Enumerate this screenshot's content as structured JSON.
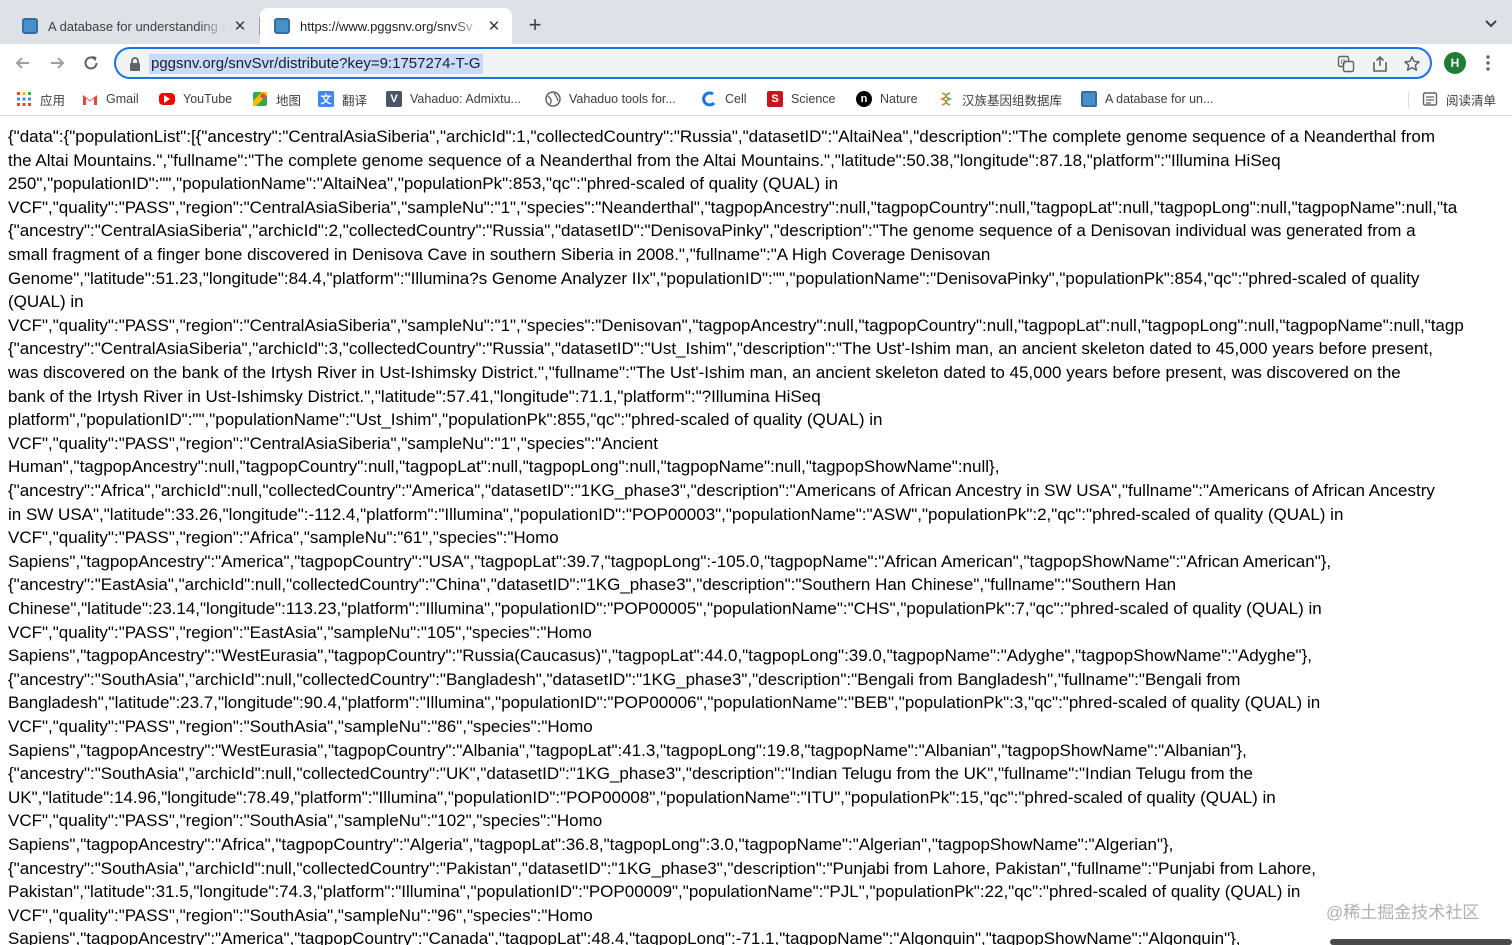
{
  "tabs": [
    {
      "title": "A database for understanding a",
      "close": "✕"
    },
    {
      "title": "https://www.pggsnv.org/snvSv",
      "close": "✕"
    }
  ],
  "new_tab": "+",
  "omnibox": {
    "url": "pggsnv.org/snvSvr/distribute?key=9:1757274-T-G"
  },
  "profile": {
    "initial": "H",
    "color": "#1e7e34"
  },
  "bookmarks": [
    {
      "label": "应用",
      "icon": "apps-grid-icon"
    },
    {
      "label": "Gmail",
      "icon": "gmail-icon"
    },
    {
      "label": "YouTube",
      "icon": "youtube-icon"
    },
    {
      "label": "地图",
      "icon": "maps-icon"
    },
    {
      "label": "翻译",
      "icon": "translate-icon"
    },
    {
      "label": "Vahaduo: Admixtu...",
      "icon": "vahaduo-icon"
    },
    {
      "label": "Vahaduo tools for...",
      "icon": "globe-icon"
    },
    {
      "label": "Cell",
      "icon": "cell-icon"
    },
    {
      "label": "Science",
      "icon": "science-icon"
    },
    {
      "label": "Nature",
      "icon": "nature-icon"
    },
    {
      "label": "汉族基因组数据库",
      "icon": "genome-db-icon"
    },
    {
      "label": "A database for un...",
      "icon": "site-favicon"
    }
  ],
  "reading_list": {
    "label": "阅读清单"
  },
  "json_lines": [
    "{\"data\":{\"populationList\":[{\"ancestry\":\"CentralAsiaSiberia\",\"archicId\":1,\"collectedCountry\":\"Russia\",\"datasetID\":\"AltaiNea\",\"description\":\"The complete genome sequence of a Neanderthal from",
    "the Altai Mountains.\",\"fullname\":\"The complete genome sequence of a Neanderthal from the Altai Mountains.\",\"latitude\":50.38,\"longitude\":87.18,\"platform\":\"Illumina HiSeq",
    "250\",\"populationID\":\"\",\"populationName\":\"AltaiNea\",\"populationPk\":853,\"qc\":\"phred-scaled of quality (QUAL) in",
    "VCF\",\"quality\":\"PASS\",\"region\":\"CentralAsiaSiberia\",\"sampleNu\":\"1\",\"species\":\"Neanderthal\",\"tagpopAncestry\":null,\"tagpopCountry\":null,\"tagpopLat\":null,\"tagpopLong\":null,\"tagpopName\":null,\"ta",
    "{\"ancestry\":\"CentralAsiaSiberia\",\"archicId\":2,\"collectedCountry\":\"Russia\",\"datasetID\":\"DenisovaPinky\",\"description\":\"The genome sequence of a Denisovan individual was generated from a",
    "small fragment of a finger bone discovered in Denisova Cave in southern Siberia in 2008.\",\"fullname\":\"A High Coverage Denisovan",
    "Genome\",\"latitude\":51.23,\"longitude\":84.4,\"platform\":\"Illumina?s Genome Analyzer IIx\",\"populationID\":\"\",\"populationName\":\"DenisovaPinky\",\"populationPk\":854,\"qc\":\"phred-scaled of quality",
    "(QUAL) in",
    "VCF\",\"quality\":\"PASS\",\"region\":\"CentralAsiaSiberia\",\"sampleNu\":\"1\",\"species\":\"Denisovan\",\"tagpopAncestry\":null,\"tagpopCountry\":null,\"tagpopLat\":null,\"tagpopLong\":null,\"tagpopName\":null,\"tagp",
    "{\"ancestry\":\"CentralAsiaSiberia\",\"archicId\":3,\"collectedCountry\":\"Russia\",\"datasetID\":\"Ust_Ishim\",\"description\":\"The Ust'-Ishim man, an ancient skeleton dated to 45,000 years before present,",
    "was discovered on the bank of the Irtysh River in Ust-Ishimsky District.\",\"fullname\":\"The Ust'-Ishim man, an ancient skeleton dated to 45,000 years before present, was discovered on the",
    "bank of the Irtysh River in Ust-Ishimsky District.\",\"latitude\":57.41,\"longitude\":71.1,\"platform\":\"?Illumina HiSeq",
    "platform\",\"populationID\":\"\",\"populationName\":\"Ust_Ishim\",\"populationPk\":855,\"qc\":\"phred-scaled of quality (QUAL) in",
    "VCF\",\"quality\":\"PASS\",\"region\":\"CentralAsiaSiberia\",\"sampleNu\":\"1\",\"species\":\"Ancient",
    "Human\",\"tagpopAncestry\":null,\"tagpopCountry\":null,\"tagpopLat\":null,\"tagpopLong\":null,\"tagpopName\":null,\"tagpopShowName\":null},",
    "{\"ancestry\":\"Africa\",\"archicId\":null,\"collectedCountry\":\"America\",\"datasetID\":\"1KG_phase3\",\"description\":\"Americans of African Ancestry in SW USA\",\"fullname\":\"Americans of African Ancestry",
    "in SW USA\",\"latitude\":33.26,\"longitude\":-112.4,\"platform\":\"Illumina\",\"populationID\":\"POP00003\",\"populationName\":\"ASW\",\"populationPk\":2,\"qc\":\"phred-scaled of quality (QUAL) in",
    "VCF\",\"quality\":\"PASS\",\"region\":\"Africa\",\"sampleNu\":\"61\",\"species\":\"Homo",
    "Sapiens\",\"tagpopAncestry\":\"America\",\"tagpopCountry\":\"USA\",\"tagpopLat\":39.7,\"tagpopLong\":-105.0,\"tagpopName\":\"African American\",\"tagpopShowName\":\"African American\"},",
    "{\"ancestry\":\"EastAsia\",\"archicId\":null,\"collectedCountry\":\"China\",\"datasetID\":\"1KG_phase3\",\"description\":\"Southern Han Chinese\",\"fullname\":\"Southern Han",
    "Chinese\",\"latitude\":23.14,\"longitude\":113.23,\"platform\":\"Illumina\",\"populationID\":\"POP00005\",\"populationName\":\"CHS\",\"populationPk\":7,\"qc\":\"phred-scaled of quality (QUAL) in",
    "VCF\",\"quality\":\"PASS\",\"region\":\"EastAsia\",\"sampleNu\":\"105\",\"species\":\"Homo",
    "Sapiens\",\"tagpopAncestry\":\"WestEurasia\",\"tagpopCountry\":\"Russia(Caucasus)\",\"tagpopLat\":44.0,\"tagpopLong\":39.0,\"tagpopName\":\"Adyghe\",\"tagpopShowName\":\"Adyghe\"},",
    "{\"ancestry\":\"SouthAsia\",\"archicId\":null,\"collectedCountry\":\"Bangladesh\",\"datasetID\":\"1KG_phase3\",\"description\":\"Bengali from Bangladesh\",\"fullname\":\"Bengali from",
    "Bangladesh\",\"latitude\":23.7,\"longitude\":90.4,\"platform\":\"Illumina\",\"populationID\":\"POP00006\",\"populationName\":\"BEB\",\"populationPk\":3,\"qc\":\"phred-scaled of quality (QUAL) in",
    "VCF\",\"quality\":\"PASS\",\"region\":\"SouthAsia\",\"sampleNu\":\"86\",\"species\":\"Homo",
    "Sapiens\",\"tagpopAncestry\":\"WestEurasia\",\"tagpopCountry\":\"Albania\",\"tagpopLat\":41.3,\"tagpopLong\":19.8,\"tagpopName\":\"Albanian\",\"tagpopShowName\":\"Albanian\"},",
    "{\"ancestry\":\"SouthAsia\",\"archicId\":null,\"collectedCountry\":\"UK\",\"datasetID\":\"1KG_phase3\",\"description\":\"Indian Telugu from the UK\",\"fullname\":\"Indian Telugu from the",
    "UK\",\"latitude\":14.96,\"longitude\":78.49,\"platform\":\"Illumina\",\"populationID\":\"POP00008\",\"populationName\":\"ITU\",\"populationPk\":15,\"qc\":\"phred-scaled of quality (QUAL) in",
    "VCF\",\"quality\":\"PASS\",\"region\":\"SouthAsia\",\"sampleNu\":\"102\",\"species\":\"Homo",
    "Sapiens\",\"tagpopAncestry\":\"Africa\",\"tagpopCountry\":\"Algeria\",\"tagpopLat\":36.8,\"tagpopLong\":3.0,\"tagpopName\":\"Algerian\",\"tagpopShowName\":\"Algerian\"},",
    "{\"ancestry\":\"SouthAsia\",\"archicId\":null,\"collectedCountry\":\"Pakistan\",\"datasetID\":\"1KG_phase3\",\"description\":\"Punjabi from Lahore, Pakistan\",\"fullname\":\"Punjabi from Lahore,",
    "Pakistan\",\"latitude\":31.5,\"longitude\":74.3,\"platform\":\"Illumina\",\"populationID\":\"POP00009\",\"populationName\":\"PJL\",\"populationPk\":22,\"qc\":\"phred-scaled of quality (QUAL) in",
    "VCF\",\"quality\":\"PASS\",\"region\":\"SouthAsia\",\"sampleNu\":\"96\",\"species\":\"Homo",
    "Sapiens\",\"tagpopAncestry\":\"America\",\"tagpopCountry\":\"Canada\",\"tagpopLat\":48.4,\"tagpopLong\":-71.1,\"tagpopName\":\"Algonquin\",\"tagpopShowName\":\"Algonquin\"},"
  ],
  "watermark": "@稀土掘金技术社区",
  "colors": {
    "accent": "#1a73e8",
    "url_highlight": "#c8dbfa",
    "tabstrip_bg": "#dee1e6"
  }
}
